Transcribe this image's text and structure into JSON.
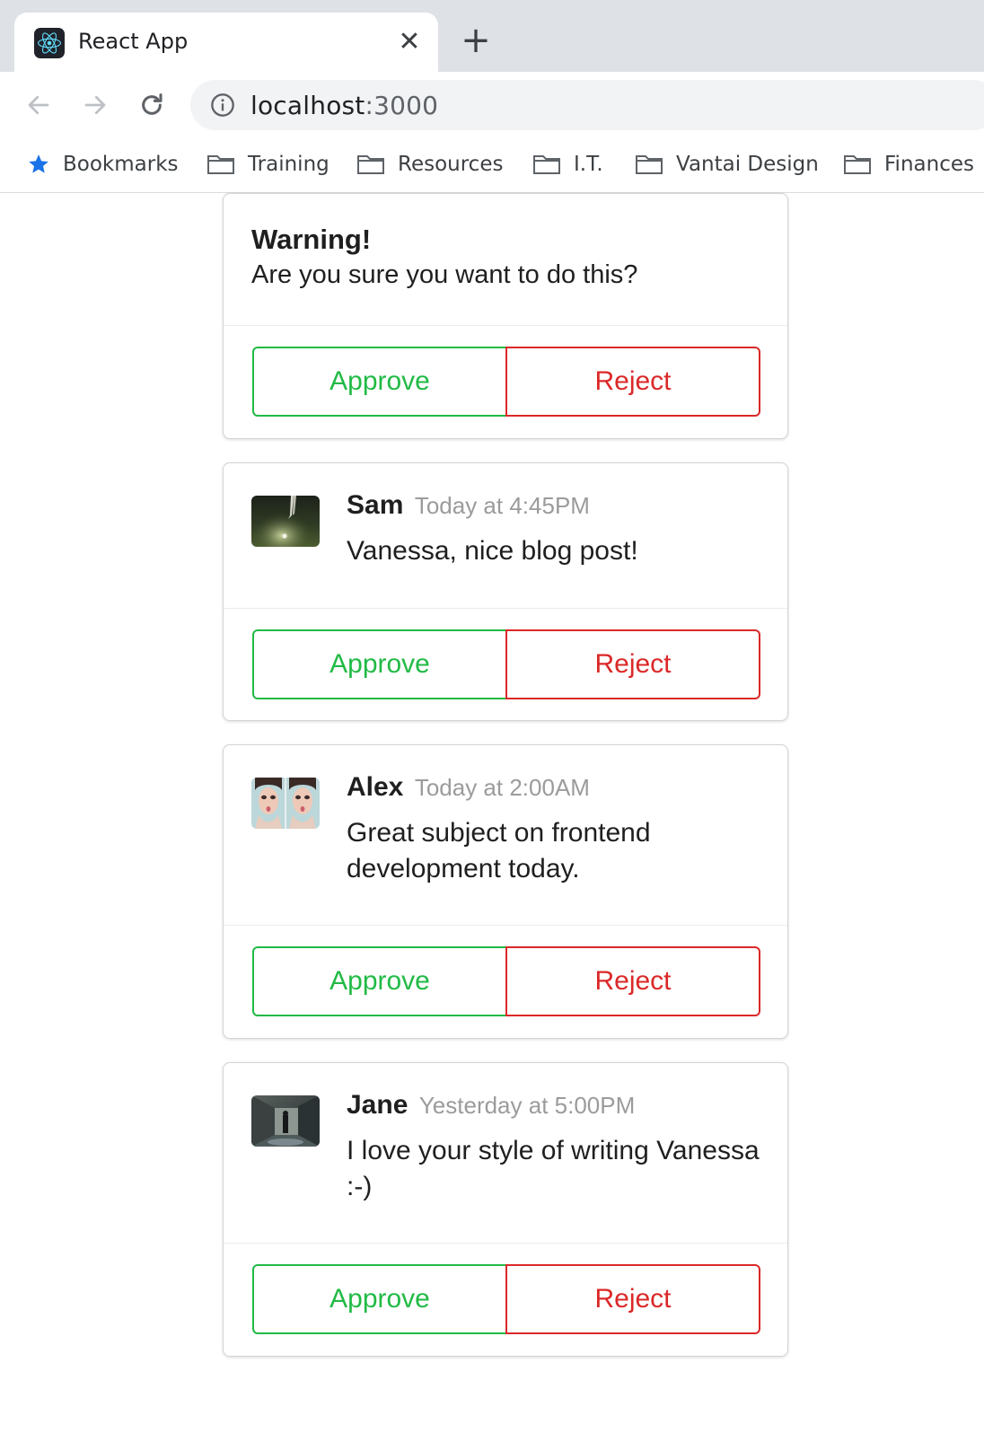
{
  "browser": {
    "tab_title": "React App",
    "tab_close_glyph": "✕",
    "new_tab_glyph": "+",
    "url_host": "localhost",
    "url_port": ":3000",
    "icons": [
      "react-favicon",
      "back-arrow-icon",
      "forward-arrow-icon",
      "reload-icon",
      "info-icon",
      "star-icon",
      "folder-icon"
    ],
    "bookmarks": [
      "Bookmarks",
      "Training",
      "Resources",
      "I.T.",
      "Vantai Design",
      "Finances"
    ]
  },
  "colors": {
    "approve": "#21ba45",
    "reject": "#db2828",
    "meta": "#9b9b9b",
    "bookmark_star": "#1a73e8"
  },
  "warning_card": {
    "title": "Warning!",
    "text": "Are you sure you want to do this?",
    "approve_label": "Approve",
    "reject_label": "Reject"
  },
  "comments": [
    {
      "author": "Sam",
      "time": "Today at 4:45PM",
      "text": "Vanessa, nice blog post!",
      "approve_label": "Approve",
      "reject_label": "Reject"
    },
    {
      "author": "Alex",
      "time": "Today at 2:00AM",
      "text": "Great subject on frontend development today.",
      "approve_label": "Approve",
      "reject_label": "Reject"
    },
    {
      "author": "Jane",
      "time": "Yesterday at 5:00PM",
      "text": "I love your style of writing Vanessa :-)",
      "approve_label": "Approve",
      "reject_label": "Reject"
    }
  ]
}
